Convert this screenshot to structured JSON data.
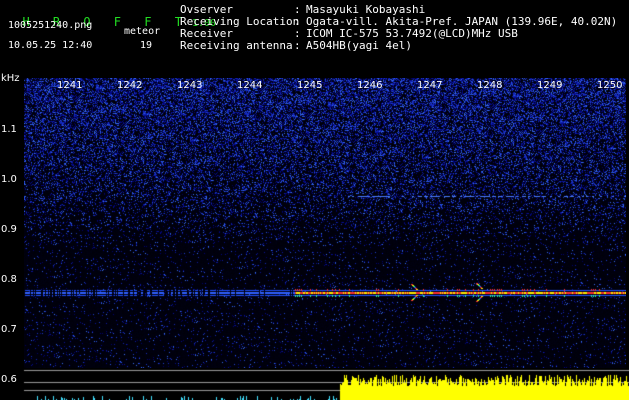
{
  "header": {
    "app_name": "H R O F F T",
    "version": "1.00",
    "file_name": "1005251240.png",
    "datetime": "10.05.25 12:40",
    "meteor_label": "meteor",
    "meteor_count": "19"
  },
  "info": [
    {
      "key": "Ovserver",
      "colon": ":",
      "value": "Masayuki Kobayashi"
    },
    {
      "key": "Receiving Location",
      "colon": ":",
      "value": "Ogata-vill. Akita-Pref. JAPAN (139.96E, 40.02N)"
    },
    {
      "key": "Receiver",
      "colon": ":",
      "value": "ICOM IC-575 53.7492(@LCD)MHz USB"
    },
    {
      "key": "Receiving antenna",
      "colon": ":",
      "value": "A504HB(yagi 4el)"
    }
  ],
  "axis": {
    "y_unit": "kHz",
    "y_labels": [
      "1.1",
      "1.0",
      "0.9",
      "0.8",
      "0.7",
      "0.6"
    ],
    "x_labels": [
      "1241",
      "1242",
      "1243",
      "1244",
      "1245",
      "1246",
      "1247",
      "1248",
      "1249",
      "1250"
    ]
  },
  "colors": {
    "title": "#22dd22",
    "noise": "#2a3cd8",
    "signal_hot": "#ff3030",
    "signal_warm": "#ffee00",
    "signal_cool": "#30ff90",
    "activity_yellow": "#ffff00",
    "activity_cyan": "#40e0ff"
  }
}
